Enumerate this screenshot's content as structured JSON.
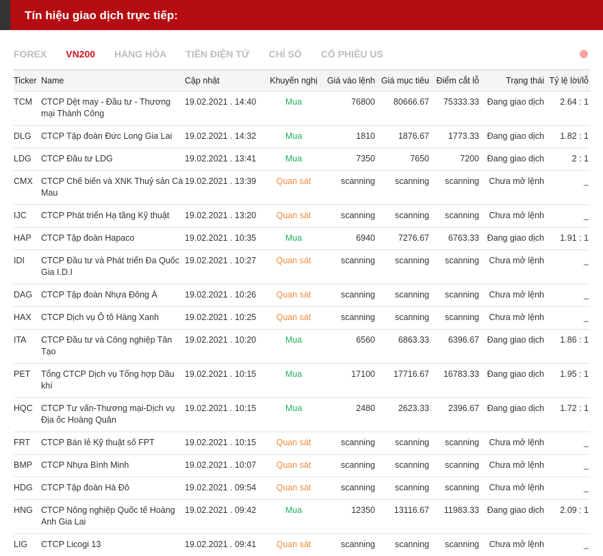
{
  "header": {
    "title": "Tín hiệu giao dịch trực tiếp:"
  },
  "tabs": [
    {
      "label": "FOREX",
      "active": false
    },
    {
      "label": "VN200",
      "active": true
    },
    {
      "label": "HÀNG HÓA",
      "active": false
    },
    {
      "label": "TIỀN ĐIỆN TỬ",
      "active": false
    },
    {
      "label": "CHỈ SỐ",
      "active": false
    },
    {
      "label": "CỔ PHIẾU US",
      "active": false
    }
  ],
  "colors": {
    "accent": "#b50c12",
    "buy": "#1cb35a",
    "watch": "#f08a3c",
    "active_tab": "#d0161d"
  },
  "table": {
    "columns": [
      "Ticker",
      "Name",
      "Cập nhật",
      "Khuyến nghị",
      "Giá vào lệnh",
      "Giá mục tiêu",
      "Điểm cắt lỗ",
      "Trạng thái",
      "Tỷ lệ lời/lỗ"
    ],
    "rows": [
      [
        "TCM",
        "CTCP Dệt may - Đầu tư - Thương mại Thành Công",
        "19.02.2021 . 14:40",
        "Mua",
        "76800",
        "80666.67",
        "75333.33",
        "Đang giao dịch",
        "2.64 : 1"
      ],
      [
        "DLG",
        "CTCP Tập đoàn Đức Long Gia Lai",
        "19.02.2021 . 14:32",
        "Mua",
        "1810",
        "1876.67",
        "1773.33",
        "Đang giao dịch",
        "1.82 : 1"
      ],
      [
        "LDG",
        "CTCP Đầu tư LDG",
        "19.02.2021 . 13:41",
        "Mua",
        "7350",
        "7650",
        "7200",
        "Đang giao dịch",
        "2 : 1"
      ],
      [
        "CMX",
        "CTCP Chế biến và XNK Thuỷ sản Cà Mau",
        "19.02.2021 . 13:39",
        "Quan sát",
        "scanning",
        "scanning",
        "scanning",
        "Chưa mở lệnh",
        "_"
      ],
      [
        "IJC",
        "CTCP Phát triển Hạ tầng Kỹ thuật",
        "19.02.2021 . 13:20",
        "Quan sát",
        "scanning",
        "scanning",
        "scanning",
        "Chưa mở lệnh",
        "_"
      ],
      [
        "HAP",
        "CTCP Tập đoàn Hapaco",
        "19.02.2021 . 10:35",
        "Mua",
        "6940",
        "7276.67",
        "6763.33",
        "Đang giao dịch",
        "1.91 : 1"
      ],
      [
        "IDI",
        "CTCP Đầu tư và Phát triển Đa Quốc Gia I.D.I",
        "19.02.2021 . 10:27",
        "Quan sát",
        "scanning",
        "scanning",
        "scanning",
        "Chưa mở lệnh",
        "_"
      ],
      [
        "DAG",
        "CTCP Tập đoàn Nhựa Đông Á",
        "19.02.2021 . 10:26",
        "Quan sát",
        "scanning",
        "scanning",
        "scanning",
        "Chưa mở lệnh",
        "_"
      ],
      [
        "HAX",
        "CTCP Dịch vụ Ô tô Hàng Xanh",
        "19.02.2021 . 10:25",
        "Quan sát",
        "scanning",
        "scanning",
        "scanning",
        "Chưa mở lệnh",
        "_"
      ],
      [
        "ITA",
        "CTCP Đầu tư và Công nghiệp Tân Tạo",
        "19.02.2021 . 10:20",
        "Mua",
        "6560",
        "6863.33",
        "6396.67",
        "Đang giao dịch",
        "1.86 : 1"
      ],
      [
        "PET",
        "Tổng CTCP Dịch vụ Tổng hợp Dầu khí",
        "19.02.2021 . 10:15",
        "Mua",
        "17100",
        "17716.67",
        "16783.33",
        "Đang giao dịch",
        "1.95 : 1"
      ],
      [
        "HQC",
        "CTCP Tư vấn-Thương mại-Dịch vụ Địa ốc Hoàng Quân",
        "19.02.2021 . 10:15",
        "Mua",
        "2480",
        "2623.33",
        "2396.67",
        "Đang giao dịch",
        "1.72 : 1"
      ],
      [
        "FRT",
        "CTCP Bán lẻ Kỹ thuật số FPT",
        "19.02.2021 . 10:15",
        "Quan sát",
        "scanning",
        "scanning",
        "scanning",
        "Chưa mở lệnh",
        "_"
      ],
      [
        "BMP",
        "CTCP Nhựa Bình Minh",
        "19.02.2021 . 10:07",
        "Quan sát",
        "scanning",
        "scanning",
        "scanning",
        "Chưa mở lệnh",
        "_"
      ],
      [
        "HDG",
        "CTCP Tập đoàn Hà Đô",
        "19.02.2021 . 09:54",
        "Quan sát",
        "scanning",
        "scanning",
        "scanning",
        "Chưa mở lệnh",
        "_"
      ],
      [
        "HNG",
        "CTCP Nông nghiệp Quốc tế Hoàng Anh Gia Lai",
        "19.02.2021 . 09:42",
        "Mua",
        "12350",
        "13116.67",
        "11983.33",
        "Đang giao dịch",
        "2.09 : 1"
      ],
      [
        "LIG",
        "CTCP Licogi 13",
        "19.02.2021 . 09:41",
        "Quan sát",
        "scanning",
        "scanning",
        "scanning",
        "Chưa mở lệnh",
        "_"
      ]
    ]
  }
}
